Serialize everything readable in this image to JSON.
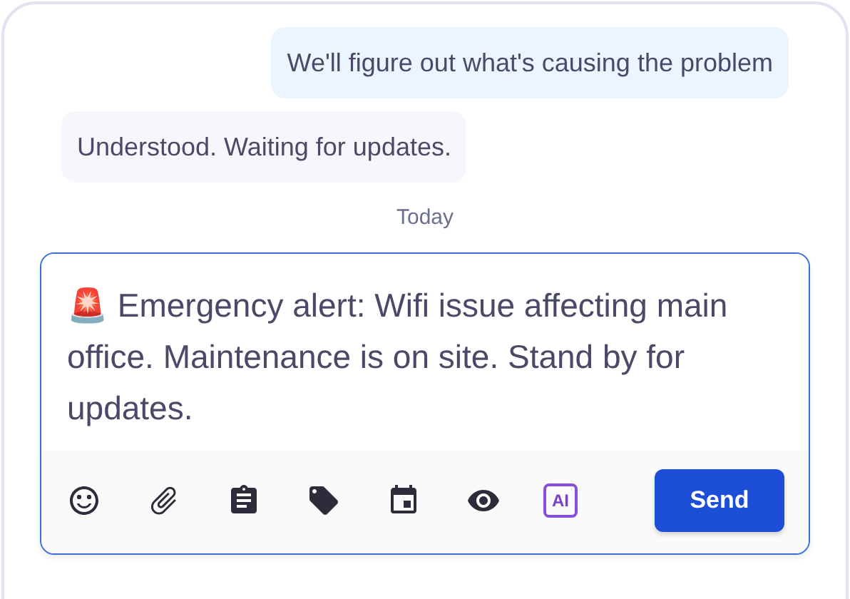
{
  "messages": [
    {
      "kind": "sent",
      "text": "We'll figure out what's causing the problem"
    },
    {
      "kind": "received",
      "text": "Understood. Waiting for updates."
    }
  ],
  "date_separator": "Today",
  "composer": {
    "value": "🚨 Emergency alert: Wifi issue affecting main office. Maintenance is on site. Stand by for updates."
  },
  "toolbar": {
    "ai_label": "AI",
    "send_label": "Send"
  }
}
